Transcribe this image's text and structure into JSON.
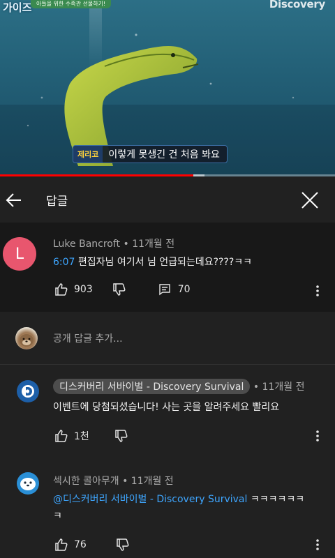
{
  "video": {
    "show_logo": "가이즈",
    "show_tag": "아들을 위한 수족관 선물하기!",
    "channel_logo": "Discovery",
    "caption_speaker": "제리코",
    "caption_text": "이렇게 못생긴 건 처음 봐요",
    "progress": 0.578,
    "buffered": 0.61
  },
  "header": {
    "title": "답글",
    "back_icon": "arrow-left-icon",
    "close_icon": "close-icon"
  },
  "main_comment": {
    "avatar_letter": "L",
    "avatar_color": "#e8566e",
    "author": "Luke Bancroft",
    "time": " • 11개월 전",
    "timestamp": "6:07",
    "text": " 편집자님 여기서 님 언급되는데요????ㅋㅋ",
    "likes": "903",
    "replies_count": "70"
  },
  "add_reply": {
    "placeholder": "공개 답글 추가..."
  },
  "replies": [
    {
      "author": "디스커버리 서바이벌 - Discovery Survival",
      "time": " • 11개월 전",
      "text": "이벤트에 당첨되셨습니다! 사는 곳을 알려주세요 빨리요",
      "likes": "1천"
    },
    {
      "author": "섹시한 콜아무개",
      "time": " • 11개월 전",
      "mention": "@디스커버리 서바이벌 - Discovery Survival",
      "text_line1": " ㅋㅋㅋㅋㅋㅋ",
      "text_line2": "ㅋ",
      "likes": "76"
    }
  ],
  "colors": {
    "accent_link": "#3ea6ff",
    "progress": "#ff0000",
    "channel_blue": "#1d5fa8"
  }
}
